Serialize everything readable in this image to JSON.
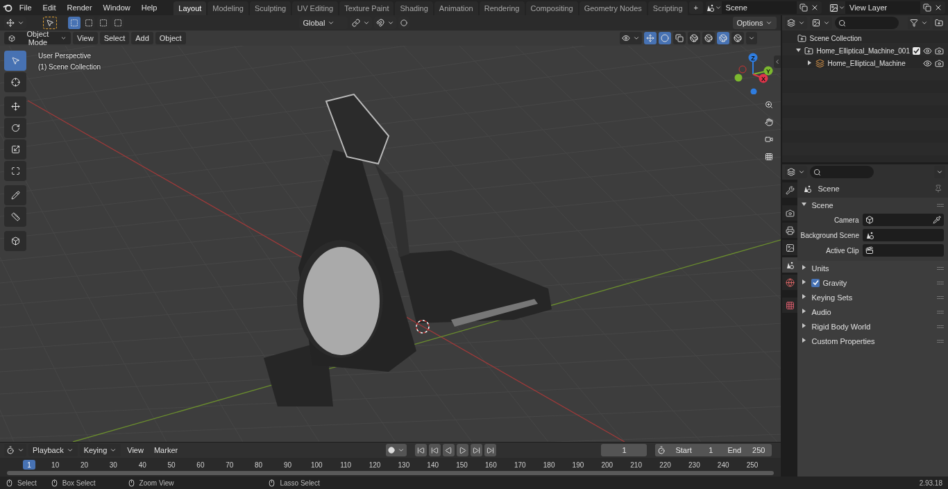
{
  "menu": [
    "File",
    "Edit",
    "Render",
    "Window",
    "Help"
  ],
  "workspace_tabs": [
    {
      "label": "Layout",
      "selected": true
    },
    {
      "label": "Modeling",
      "selected": false
    },
    {
      "label": "Sculpting",
      "selected": false
    },
    {
      "label": "UV Editing",
      "selected": false
    },
    {
      "label": "Texture Paint",
      "selected": false
    },
    {
      "label": "Shading",
      "selected": false
    },
    {
      "label": "Animation",
      "selected": false
    },
    {
      "label": "Rendering",
      "selected": false
    },
    {
      "label": "Compositing",
      "selected": false
    },
    {
      "label": "Geometry Nodes",
      "selected": false
    },
    {
      "label": "Scripting",
      "selected": false
    }
  ],
  "add_tab": "+",
  "scene_field": "Scene",
  "view_layer_field": "View Layer",
  "tool_header": {
    "select_modes": [
      {
        "selected": true
      },
      {
        "selected": false
      },
      {
        "selected": false
      },
      {
        "selected": false
      }
    ],
    "orientation": "Global",
    "options": "Options"
  },
  "viewport_header": {
    "mode": "Object Mode",
    "menus": [
      "View",
      "Select",
      "Add",
      "Object"
    ],
    "shading_modes": [
      {
        "selected": false
      },
      {
        "selected": false
      },
      {
        "selected": true
      },
      {
        "selected": false
      }
    ]
  },
  "viewport": {
    "overlay_lines": [
      "User Perspective",
      "(1) Scene Collection"
    ],
    "tools": [
      {
        "selected": true
      },
      {
        "selected": false
      },
      {
        "selected": false
      },
      {
        "selected": false
      },
      {
        "selected": false
      },
      {
        "selected": false
      },
      {
        "selected": false
      },
      {
        "selected": false
      },
      {
        "selected": false
      }
    ],
    "gizmo_axes": [
      "Z",
      "Y",
      "X"
    ]
  },
  "outliner": {
    "root": "Scene Collection",
    "children": [
      {
        "label": "Home_Elliptical_Machine_001",
        "kind": "collection",
        "checked": true,
        "expanded": true,
        "children": [
          {
            "label": "Home_Elliptical_Machine",
            "kind": "object",
            "expanded": false
          }
        ]
      }
    ]
  },
  "properties": {
    "tabs": [
      {
        "selected": false
      },
      {
        "selected": false
      },
      {
        "selected": false
      },
      {
        "selected": false
      },
      {
        "selected": true
      },
      {
        "selected": false
      },
      {
        "selected": false
      }
    ],
    "title": "Scene",
    "panels": [
      {
        "label": "Scene",
        "kind": "plain",
        "expanded": true,
        "fields": [
          {
            "label": "Camera"
          },
          {
            "label": "Background Scene"
          },
          {
            "label": "Active Clip"
          }
        ]
      },
      {
        "label": "Units",
        "kind": "plain",
        "expanded": false
      },
      {
        "label": "Gravity",
        "kind": "checkbox",
        "checked": true,
        "expanded": false
      },
      {
        "label": "Keying Sets",
        "kind": "plain",
        "expanded": false
      },
      {
        "label": "Audio",
        "kind": "plain",
        "expanded": false
      },
      {
        "label": "Rigid Body World",
        "kind": "plain",
        "expanded": false
      },
      {
        "label": "Custom Properties",
        "kind": "plain",
        "expanded": false
      }
    ]
  },
  "timeline": {
    "menus": [
      "Playback",
      "Keying",
      "View",
      "Marker"
    ],
    "current_frame": "1",
    "start_label": "Start",
    "start": "1",
    "end_label": "End",
    "end": "250",
    "playhead": "1",
    "ticks": [
      "10",
      "20",
      "30",
      "40",
      "50",
      "60",
      "70",
      "80",
      "90",
      "100",
      "110",
      "120",
      "130",
      "140",
      "150",
      "160",
      "170",
      "180",
      "190",
      "200",
      "210",
      "220",
      "230",
      "240",
      "250"
    ]
  },
  "status_bar": {
    "items": [
      "Select",
      "Box Select",
      "Zoom View",
      "Lasso Select"
    ],
    "version": "2.93.18"
  }
}
